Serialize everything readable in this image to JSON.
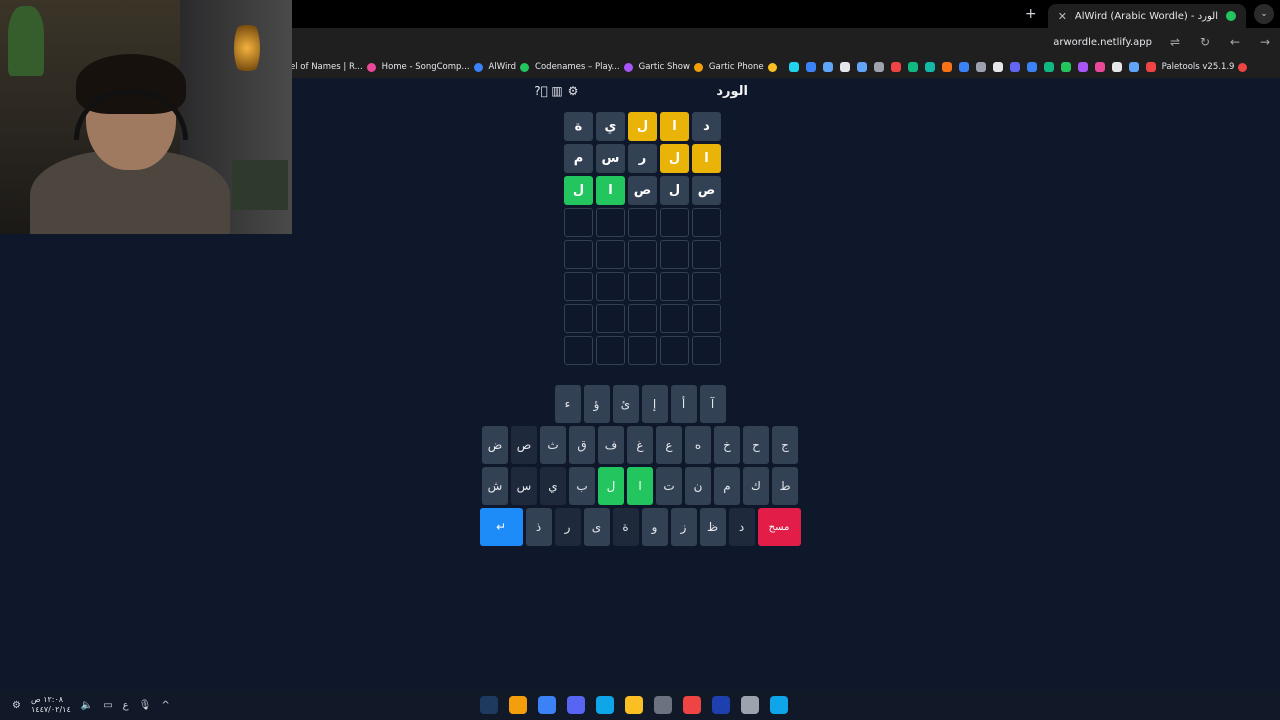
{
  "browser": {
    "tab_title": "AlWird (Arabic Wordle) - الورد",
    "url": "arwordle.netlify.app",
    "bookmarks": [
      "el of Names | R...",
      "Home - SongComp...",
      "AlWird",
      "Codenames – Play...",
      "Gartic Show",
      "Gartic Phone",
      "Paletools v25.1.9"
    ],
    "bookmark_colors": [
      "#ec4899",
      "#3b82f6",
      "#22c55e",
      "#a855f7",
      "#f59e0b",
      "#fbbf24",
      "#ef4444"
    ],
    "bookmark_icon_colors": [
      "#22d3ee",
      "#3b82f6",
      "#60a5fa",
      "#e5e7eb",
      "#60a5fa",
      "#9ca3af",
      "#ef4444",
      "#10b981",
      "#14b8a6",
      "#f97316",
      "#3b82f6",
      "#9ca3af",
      "#e5e7eb",
      "#6366f1",
      "#3b82f6",
      "#10b981",
      "#22c55e",
      "#a855f7",
      "#ec4899",
      "#e5e7eb",
      "#60a5fa",
      "#ef4444"
    ]
  },
  "game": {
    "title": "الورد",
    "board": [
      [
        {
          "l": "د",
          "s": "absent"
        },
        {
          "l": "ا",
          "s": "present"
        },
        {
          "l": "ل",
          "s": "present"
        },
        {
          "l": "ي",
          "s": "absent"
        },
        {
          "l": "ة",
          "s": "absent"
        }
      ],
      [
        {
          "l": "ا",
          "s": "present"
        },
        {
          "l": "ل",
          "s": "present"
        },
        {
          "l": "ر",
          "s": "absent"
        },
        {
          "l": "س",
          "s": "absent"
        },
        {
          "l": "م",
          "s": "absent"
        }
      ],
      [
        {
          "l": "ص",
          "s": "absent"
        },
        {
          "l": "ل",
          "s": "absent"
        },
        {
          "l": "ص",
          "s": "absent"
        },
        {
          "l": "ا",
          "s": "correct"
        },
        {
          "l": "ل",
          "s": "correct"
        }
      ],
      [
        {
          "l": "",
          "s": "empty"
        },
        {
          "l": "",
          "s": "empty"
        },
        {
          "l": "",
          "s": "empty"
        },
        {
          "l": "",
          "s": "empty"
        },
        {
          "l": "",
          "s": "empty"
        }
      ],
      [
        {
          "l": "",
          "s": "empty"
        },
        {
          "l": "",
          "s": "empty"
        },
        {
          "l": "",
          "s": "empty"
        },
        {
          "l": "",
          "s": "empty"
        },
        {
          "l": "",
          "s": "empty"
        }
      ],
      [
        {
          "l": "",
          "s": "empty"
        },
        {
          "l": "",
          "s": "empty"
        },
        {
          "l": "",
          "s": "empty"
        },
        {
          "l": "",
          "s": "empty"
        },
        {
          "l": "",
          "s": "empty"
        }
      ],
      [
        {
          "l": "",
          "s": "empty"
        },
        {
          "l": "",
          "s": "empty"
        },
        {
          "l": "",
          "s": "empty"
        },
        {
          "l": "",
          "s": "empty"
        },
        {
          "l": "",
          "s": "empty"
        }
      ],
      [
        {
          "l": "",
          "s": "empty"
        },
        {
          "l": "",
          "s": "empty"
        },
        {
          "l": "",
          "s": "empty"
        },
        {
          "l": "",
          "s": "empty"
        },
        {
          "l": "",
          "s": "empty"
        }
      ]
    ],
    "keyboard": [
      [
        {
          "k": "آ"
        },
        {
          "k": "أ"
        },
        {
          "k": "إ"
        },
        {
          "k": "ئ"
        },
        {
          "k": "ؤ"
        },
        {
          "k": "ء"
        }
      ],
      [
        {
          "k": "ج"
        },
        {
          "k": "ح"
        },
        {
          "k": "خ"
        },
        {
          "k": "ه"
        },
        {
          "k": "ع"
        },
        {
          "k": "غ"
        },
        {
          "k": "ف"
        },
        {
          "k": "ق"
        },
        {
          "k": "ث"
        },
        {
          "k": "ص",
          "s": "used"
        },
        {
          "k": "ض"
        }
      ],
      [
        {
          "k": "ط"
        },
        {
          "k": "ك"
        },
        {
          "k": "م"
        },
        {
          "k": "ن"
        },
        {
          "k": "ت"
        },
        {
          "k": "ا",
          "s": "correct"
        },
        {
          "k": "ل",
          "s": "correct"
        },
        {
          "k": "ب"
        },
        {
          "k": "ي",
          "s": "used"
        },
        {
          "k": "س",
          "s": "used"
        },
        {
          "k": "ش"
        }
      ],
      [
        {
          "k": "مسح",
          "s": "del"
        },
        {
          "k": "د",
          "s": "used"
        },
        {
          "k": "ظ"
        },
        {
          "k": "ز"
        },
        {
          "k": "و"
        },
        {
          "k": "ة",
          "s": "used"
        },
        {
          "k": "ى"
        },
        {
          "k": "ر",
          "s": "used"
        },
        {
          "k": "ذ"
        },
        {
          "k": "↵",
          "s": "enter"
        }
      ]
    ]
  },
  "taskbar": {
    "time": "١٢:٠٨ ص",
    "date": "١٤٤٧/٠٢/١٤",
    "lang": "ع",
    "app_colors": [
      "#1e3a5f",
      "#f59e0b",
      "#3b82f6",
      "#5865f2",
      "#0ea5e9",
      "#fbbf24",
      "#6b7280",
      "#ef4444",
      "#1e40af",
      "#9ca3af",
      "#0ea5e9"
    ]
  }
}
